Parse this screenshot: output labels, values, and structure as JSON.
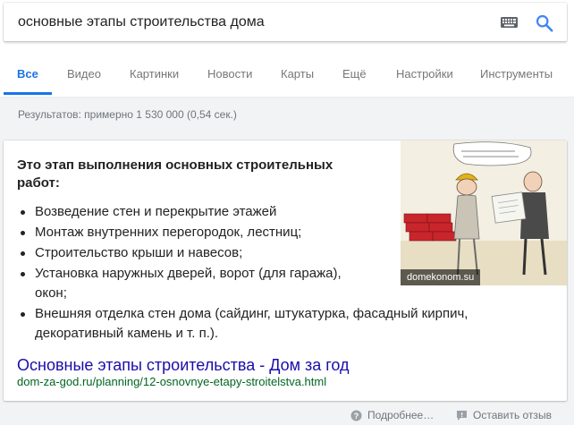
{
  "search": {
    "query": "основные этапы строительства дома",
    "keyboard_icon": "keyboard-icon",
    "search_icon": "search-icon"
  },
  "tabs": [
    {
      "label": "Все",
      "active": true
    },
    {
      "label": "Видео"
    },
    {
      "label": "Картинки"
    },
    {
      "label": "Новости"
    },
    {
      "label": "Карты"
    },
    {
      "label": "Ещё"
    },
    {
      "label": "Настройки"
    },
    {
      "label": "Инструменты"
    }
  ],
  "results_count": "Результатов: примерно 1 530 000 (0,54 сек.)",
  "snippet": {
    "heading": "Это этап выполнения основных строительных работ:",
    "bullets": [
      "Возведение стен и перекрытие этажей",
      "Монтаж внутренних перегородок, лестниц;",
      "Строительство крыши и навесов;",
      "Установка наружных дверей, ворот (для гаража), окон;",
      "Внешняя отделка стен дома (сайдинг, штукатурка, фасадный кирпич, декоративный камень и т. п.)."
    ],
    "image_caption": "domekonom.su",
    "result_title": "Основные этапы строительства - Дом за год",
    "result_url": "dom-za-god.ru/planning/12-osnovnye-etapy-stroitelstva.html"
  },
  "footer": {
    "more_info": "Подробнее…",
    "feedback": "Оставить отзыв"
  },
  "colors": {
    "accent": "#1a73e8",
    "link": "#1a0dab",
    "url": "#006621"
  }
}
